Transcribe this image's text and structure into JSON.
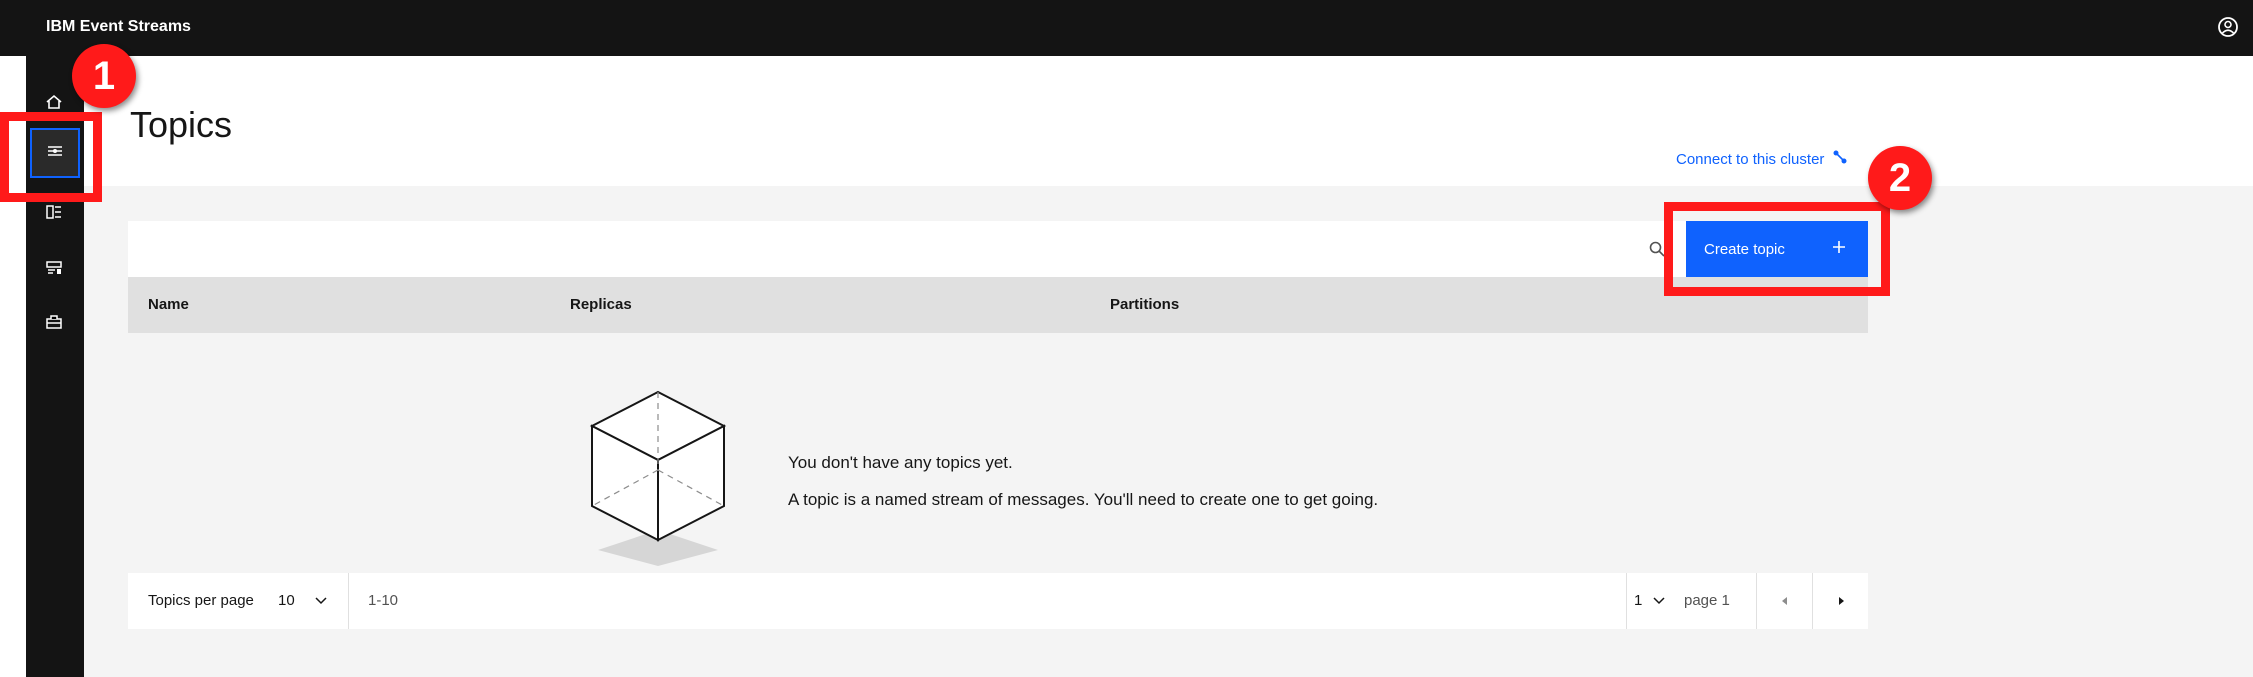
{
  "header": {
    "title": "IBM Event Streams",
    "user_icon": "user-avatar-icon"
  },
  "sidebar": {
    "items": [
      {
        "name": "home",
        "icon": "home-icon"
      },
      {
        "name": "topics",
        "icon": "topics-icon",
        "active": true
      },
      {
        "name": "consumer-groups",
        "icon": "consumer-groups-icon"
      },
      {
        "name": "schema-registry",
        "icon": "schema-registry-icon"
      },
      {
        "name": "toolbox",
        "icon": "toolbox-icon"
      }
    ]
  },
  "page": {
    "title": "Topics",
    "connect_link": "Connect to this cluster"
  },
  "toolbar": {
    "create_label": "Create topic"
  },
  "table": {
    "columns": [
      "Name",
      "Replicas",
      "Partitions"
    ]
  },
  "empty_state": {
    "title": "You don't have any topics yet.",
    "description": "A topic is a named stream of messages. You'll need to create one to get going."
  },
  "pagination": {
    "per_page_label": "Topics per page",
    "per_page_value": "10",
    "range": "1-10",
    "page_value": "1",
    "page_of": "page 1"
  },
  "callouts": {
    "one": "1",
    "two": "2"
  },
  "colors": {
    "accent": "#0f62fe",
    "header": "#141414",
    "callout": "#ff1a1a"
  }
}
